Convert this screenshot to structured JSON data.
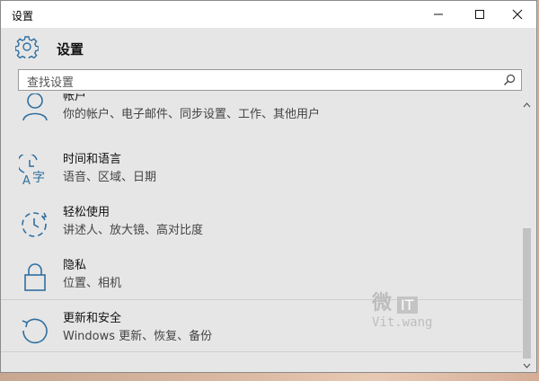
{
  "window": {
    "title": "设置"
  },
  "header": {
    "title": "设置"
  },
  "search": {
    "placeholder": "查找设置"
  },
  "items": [
    {
      "name": "帐户",
      "desc": "你的帐户、电子邮件、同步设置、工作、其他用户",
      "icon": "person-icon"
    },
    {
      "name": "时间和语言",
      "desc": "语音、区域、日期",
      "icon": "time-language-icon"
    },
    {
      "name": "轻松使用",
      "desc": "讲述人、放大镜、高对比度",
      "icon": "ease-of-access-icon"
    },
    {
      "name": "隐私",
      "desc": "位置、相机",
      "icon": "lock-icon"
    },
    {
      "name": "更新和安全",
      "desc": "Windows 更新、恢复、备份",
      "icon": "update-icon"
    }
  ],
  "watermark": {
    "top": "微",
    "it": "IT",
    "bottom": "Vit.wang"
  },
  "colors": {
    "accent": "#2f6fa0"
  }
}
